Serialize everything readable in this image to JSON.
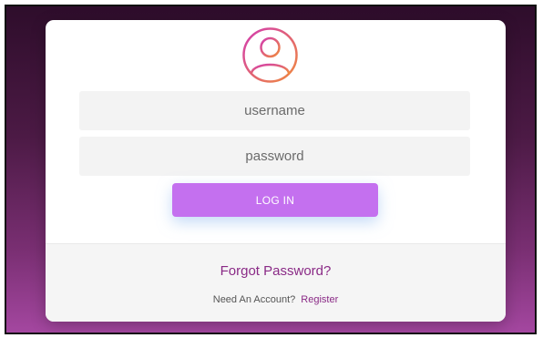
{
  "login_form": {
    "avatar_icon": "user-icon",
    "username_placeholder": "username",
    "password_placeholder": "password",
    "login_label": "LOG IN",
    "forgot_label": "Forgot Password?",
    "account_prompt": "Need An Account?",
    "register_label": "Register"
  },
  "colors": {
    "background_top": "#2e0d2b",
    "background_bottom": "#a447a0",
    "button": "#c470ef",
    "link": "#8a2a86",
    "avatar_gradient": [
      "#d23bb0",
      "#f08a3c"
    ]
  }
}
